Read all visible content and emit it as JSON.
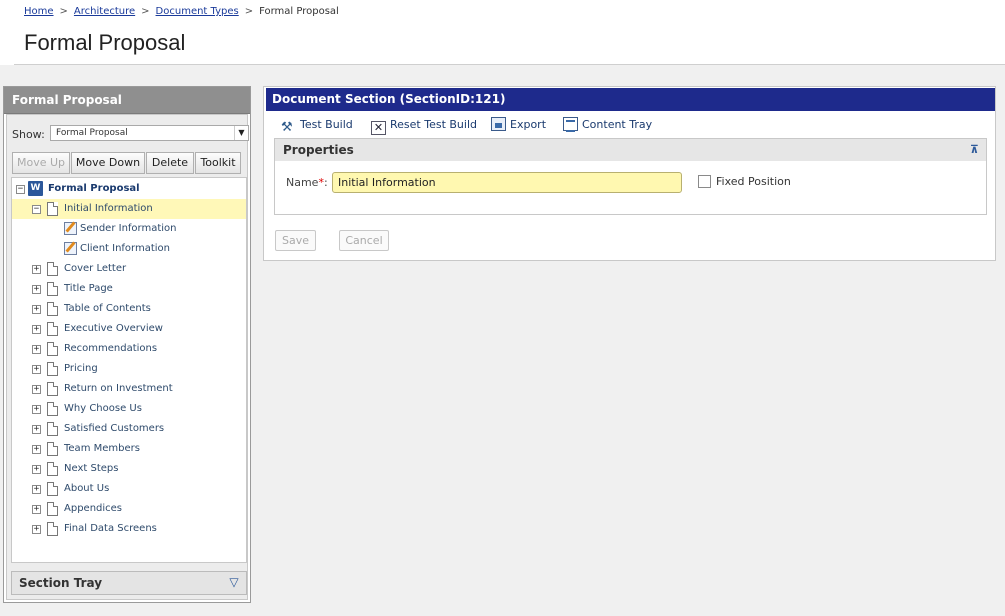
{
  "breadcrumb": {
    "items": [
      "Home",
      "Architecture",
      "Document Types"
    ],
    "current": "Formal Proposal",
    "separator": ">"
  },
  "page": {
    "title": "Formal Proposal"
  },
  "left_panel": {
    "title": "Formal Proposal",
    "show_label": "Show:",
    "show_value": "Formal Proposal",
    "buttons": {
      "move_up": "Move Up",
      "move_down": "Move Down",
      "delete": "Delete",
      "toolkit": "Toolkit"
    },
    "tree": {
      "root": "Formal Proposal",
      "selected": "Initial Information",
      "selected_children": [
        "Sender Information",
        "Client Information"
      ],
      "items": [
        "Cover Letter",
        "Title Page",
        "Table of Contents",
        "Executive Overview",
        "Recommendations",
        "Pricing",
        "Return on Investment",
        "Why Choose Us",
        "Satisfied Customers",
        "Team Members",
        "Next Steps",
        "About Us",
        "Appendices",
        "Final Data Screens"
      ]
    },
    "section_tray": "Section Tray"
  },
  "main_panel": {
    "title": "Document Section (SectionID:121)",
    "actions": {
      "test_build": "Test Build",
      "reset_test_build": "Reset Test Build",
      "export": "Export",
      "content_tray": "Content Tray"
    },
    "properties": {
      "heading": "Properties",
      "name_label": "Name",
      "required_mark": "*",
      "name_colon": ":",
      "name_value": "Initial Information",
      "fixed_position_label": "Fixed Position",
      "fixed_position_checked": false
    },
    "buttons": {
      "save": "Save",
      "cancel": "Cancel"
    }
  },
  "colors": {
    "title_bar": "#1e2a8c",
    "selected_row": "#fff8b8",
    "input_highlight": "#fff8b0",
    "link": "#1a3a9a"
  }
}
